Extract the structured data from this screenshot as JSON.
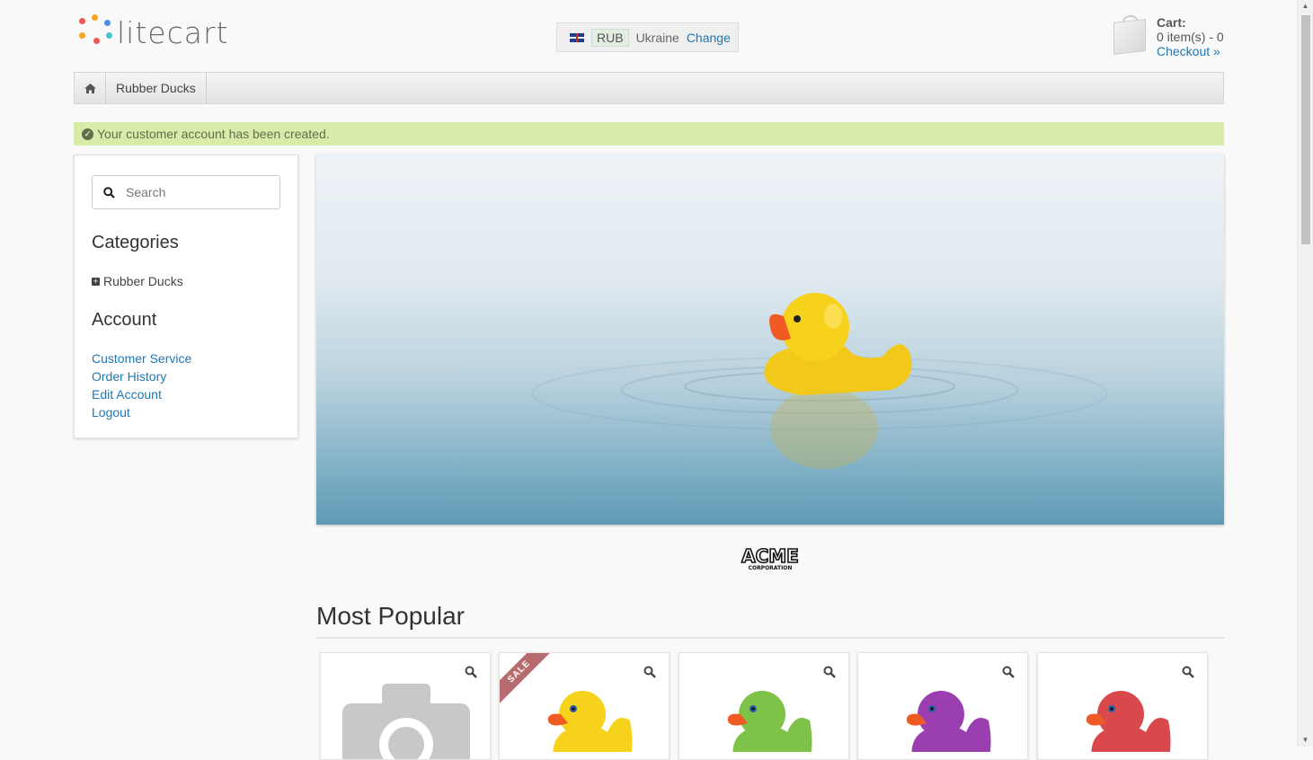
{
  "header": {
    "logo_text": "litecart",
    "regional": {
      "currency": "RUB",
      "country": "Ukraine",
      "change_label": "Change"
    },
    "cart": {
      "title": "Cart:",
      "summary": "0 item(s) - 0",
      "checkout_label": "Checkout »"
    }
  },
  "breadcrumb": {
    "home_icon": "home-icon",
    "items": [
      "Rubber Ducks"
    ]
  },
  "notice": {
    "message": "Your customer account has been created."
  },
  "sidebar": {
    "search_placeholder": "Search",
    "categories_title": "Categories",
    "categories": [
      "Rubber Ducks"
    ],
    "account_title": "Account",
    "account_links": [
      "Customer Service",
      "Order History",
      "Edit Account",
      "Logout"
    ]
  },
  "brand": {
    "name": "ACME",
    "sub": "CORPORATION"
  },
  "most_popular": {
    "title": "Most Popular",
    "products": [
      {
        "image": "camera-placeholder",
        "sale": false,
        "color": "#c8c8c8"
      },
      {
        "image": "yellow-duck",
        "sale": true,
        "sale_label": "SALE",
        "color": "#f7d21c"
      },
      {
        "image": "green-duck",
        "sale": false,
        "color": "#7ec24a"
      },
      {
        "image": "purple-duck",
        "sale": false,
        "color": "#9b3fb0"
      },
      {
        "image": "red-duck",
        "sale": false,
        "color": "#d9484b"
      }
    ]
  },
  "colors": {
    "link": "#1f77b4",
    "notice_bg": "#d8ecaa",
    "sale": "#b86b6f"
  }
}
